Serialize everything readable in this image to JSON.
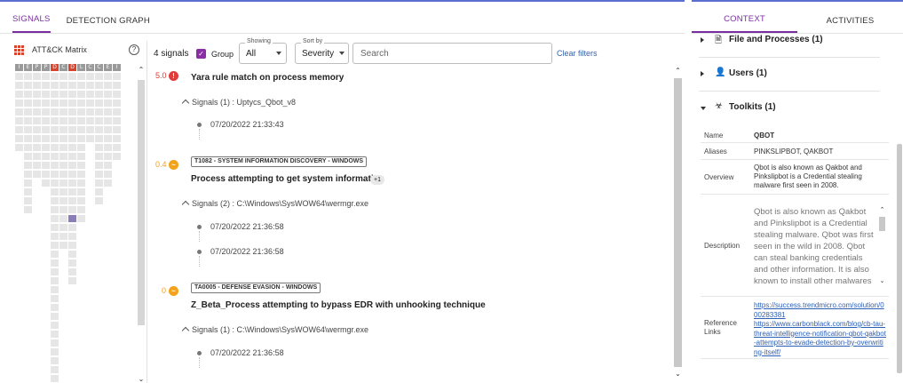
{
  "left_tabs": {
    "signals": "SIGNALS",
    "detection_graph": "DETECTION GRAPH"
  },
  "matrix": {
    "title": "ATT&CK Matrix",
    "help": "?",
    "tactics": [
      "I",
      "E",
      "P",
      "P",
      "D",
      "C",
      "D",
      "L",
      "C",
      "C",
      "E",
      "I"
    ],
    "tactics_highlighted": [
      4,
      6
    ]
  },
  "toolbar": {
    "count": "4 signals",
    "group_label": "Group",
    "showing_label": "Showing",
    "showing_value": "All",
    "sort_label": "Sort by",
    "sort_value": "Severity",
    "search_placeholder": "Search",
    "clear_filters": "Clear filters"
  },
  "signals": [
    {
      "score": "5.0",
      "badge": "!",
      "tag": "",
      "title": "Yara rule match on process memory",
      "group": "Signals (1) : Uptycs_Qbot_v8",
      "times": [
        "07/20/2022 21:33:43"
      ]
    },
    {
      "score": "0.4",
      "badge": "~",
      "tag": "T1082 - SYSTEM INFORMATION DISCOVERY - WINDOWS",
      "title": "Process attempting to get system information",
      "extra": "+1",
      "group": "Signals (2) : C:\\Windows\\SysWOW64\\wermgr.exe",
      "times": [
        "07/20/2022 21:36:58",
        "07/20/2022 21:36:58"
      ]
    },
    {
      "score": "0",
      "badge": "~",
      "tag": "TA0005 - DEFENSE EVASION - WINDOWS",
      "title": "Z_Beta_Process attempting to bypass EDR with unhooking technique",
      "group": "Signals (1) : C:\\Windows\\SysWOW64\\wermgr.exe",
      "times": [
        "07/20/2022 21:36:58"
      ]
    }
  ],
  "right_tabs": {
    "context": "CONTEXT",
    "activities": "ACTIVITIES"
  },
  "context": {
    "sections": {
      "files": "File and Processes (1)",
      "users": "Users (1)",
      "toolkits": "Toolkits (1)"
    },
    "toolkit": {
      "name_key": "Name",
      "name": "QBOT",
      "aliases_key": "Aliases",
      "aliases": "PINKSLIPBOT, QAKBOT",
      "overview_key": "Overview",
      "overview": "Qbot is also known as Qakbot and Pinkslipbot is a Credential stealing malware first seen in 2008.",
      "description_key": "Description",
      "description": "Qbot is also known as Qakbot and Pinkslipbot is a Credential stealing malware. Qbot was first seen in the wild in 2008. Qbot can steal banking credentials and other information. It is also known to install other malwares",
      "reference_key": "Reference Links",
      "links": [
        "https://success.trendmicro.com/solution/000283381",
        "https://www.carbonblack.com/blog/cb-tau-threat-intelligence-notification-qbot-qakbot-attempts-to-evade-detection-by-overwriting-itself/"
      ]
    }
  },
  "colors": {
    "accent": "#7a2fa0",
    "critical": "#e03a3a",
    "warning": "#f2a21b",
    "link": "#2c5fb6"
  }
}
